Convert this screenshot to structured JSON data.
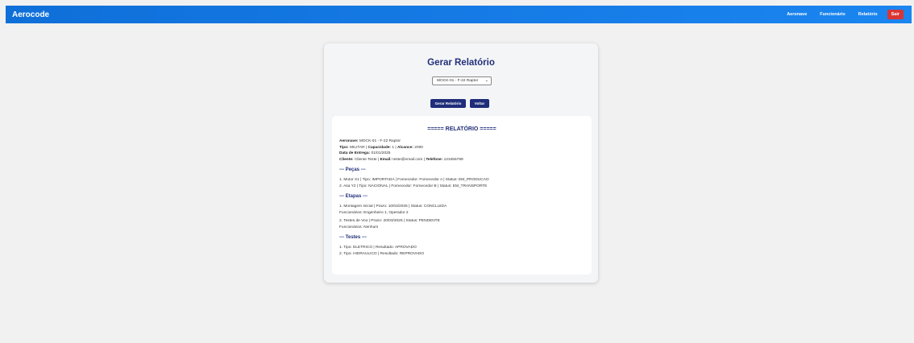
{
  "header": {
    "brand": "Aerocode",
    "nav": [
      "Aeronave",
      "Funcionário",
      "Relatório"
    ],
    "exit_label": "Sair"
  },
  "form": {
    "title": "Gerar Relatório",
    "select_value": "MOCK-01 - F-22 Raptor",
    "generate_label": "Gerar Relatório",
    "back_label": "Voltar"
  },
  "report": {
    "title": "===== RELATÓRIO =====",
    "aeronave_label": "Aeronave:",
    "aeronave_value": "MOCK-01 - F-22 Raptor",
    "tipo_label": "Tipo:",
    "tipo_value": "MILITAR",
    "capacidade_label": "Capacidade:",
    "capacidade_value": "1",
    "alcance_label": "Alcance:",
    "alcance_value": "2000",
    "entrega_label": "Data de Entrega:",
    "entrega_value": "01/01/2025",
    "cliente_label": "Cliente:",
    "cliente_value": "Cliente Teste",
    "email_label": "Email:",
    "email_value": "teste@email.com",
    "telefone_label": "Telefone:",
    "telefone_value": "123456789",
    "pecas_title": "--- Peças ---",
    "pecas": [
      "1. Motor X1 | Tipo: IMPORTADA | Fornecedor: Fornecedor A | Status: EM_PRODUCAO",
      "2. Asa Y2 | Tipo: NACIONAL | Fornecedor: Fornecedor B | Status: EM_TRANSPORTE"
    ],
    "etapas_title": "--- Etapas ---",
    "etapas": [
      {
        "line": "1. Montagem Inicial | Prazo: 10/03/2025 | Status: CONCLUIDA",
        "func": "Funcionários: Engenheiro 1, Operador 2"
      },
      {
        "line": "2. Testes de Voo | Prazo: 20/03/2025 | Status: PENDENTE",
        "func": "Funcionários: Nenhum"
      }
    ],
    "testes_title": "--- Testes ---",
    "testes": [
      "1. Tipo: ELETRICO | Resultado: APROVADO",
      "2. Tipo: HIDRAULICO | Resultado: REPROVADO"
    ]
  }
}
